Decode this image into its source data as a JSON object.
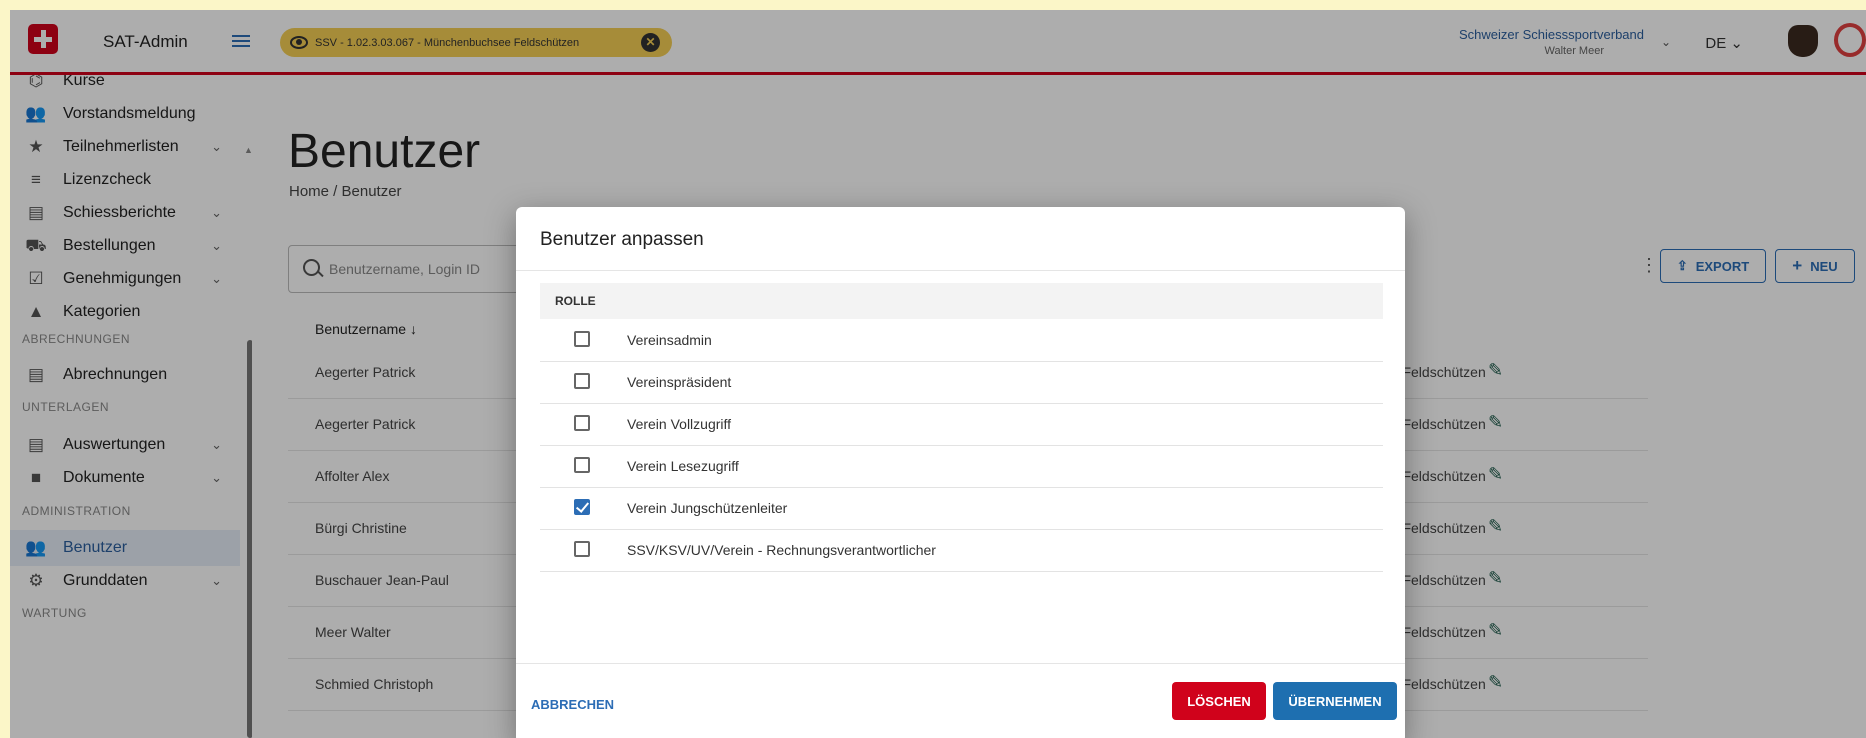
{
  "header": {
    "app_name": "SAT-Admin",
    "context_chip": "SSV - 1.02.3.03.067 - Münchenbuchsee Feldschützen",
    "org_name": "Schweizer Schiesssportverband",
    "user_name": "Walter Meer",
    "language": "DE"
  },
  "sidebar": {
    "items": [
      {
        "label": "Kurse",
        "icon": "course-icon"
      },
      {
        "label": "Vorstandsmeldung",
        "icon": "people-icon"
      },
      {
        "label": "Teilnehmerlisten",
        "icon": "star-icon"
      },
      {
        "label": "Lizenzcheck",
        "icon": "list-check-icon"
      },
      {
        "label": "Schiessberichte",
        "icon": "document-icon"
      },
      {
        "label": "Bestellungen",
        "icon": "cart-icon"
      },
      {
        "label": "Genehmigungen",
        "icon": "approval-icon"
      },
      {
        "label": "Kategorien",
        "icon": "category-icon"
      },
      {
        "label": "Abrechnungen",
        "icon": "ledger-icon"
      },
      {
        "label": "Auswertungen",
        "icon": "report-icon"
      },
      {
        "label": "Dokumente",
        "icon": "folder-icon"
      },
      {
        "label": "Benutzer",
        "icon": "people-icon"
      },
      {
        "label": "Grunddaten",
        "icon": "gear-icon"
      }
    ],
    "sections": [
      "ABRECHNUNGEN",
      "UNTERLAGEN",
      "ADMINISTRATION",
      "WARTUNG"
    ]
  },
  "page": {
    "title": "Benutzer",
    "breadcrumb": "Home / Benutzer",
    "search_placeholder": "Benutzername, Login ID",
    "column_username": "Benutzername ↓",
    "export_label": "EXPORT",
    "new_label": "NEU"
  },
  "table": {
    "rows": [
      {
        "name": "Aegerter Patrick",
        "verein": "ee Feldschützen"
      },
      {
        "name": "Aegerter Patrick",
        "verein": "ee Feldschützen"
      },
      {
        "name": "Affolter Alex",
        "verein": "ee Feldschützen"
      },
      {
        "name": "Bürgi Christine",
        "verein": "ee Feldschützen"
      },
      {
        "name": "Buschauer Jean-Paul",
        "verein": "ee Feldschützen"
      },
      {
        "name": "Meer Walter",
        "verein": "ee Feldschützen"
      },
      {
        "name": "Schmied Christoph",
        "verein": "ee Feldschützen"
      }
    ]
  },
  "dialog": {
    "title": "Benutzer anpassen",
    "column_role": "ROLLE",
    "roles": [
      {
        "label": "Vereinsadmin",
        "checked": false
      },
      {
        "label": "Vereinspräsident",
        "checked": false
      },
      {
        "label": "Verein Vollzugriff",
        "checked": false
      },
      {
        "label": "Verein Lesezugriff",
        "checked": false
      },
      {
        "label": "Verein Jungschützenleiter",
        "checked": true
      },
      {
        "label": "SSV/KSV/UV/Verein - Rechnungsverantwortlicher",
        "checked": false
      }
    ],
    "cancel_label": "ABBRECHEN",
    "delete_label": "LÖSCHEN",
    "apply_label": "ÜBERNEHMEN"
  },
  "colors": {
    "brand_red": "#d0021b",
    "primary_blue": "#2c6db5",
    "chip_yellow": "#f5cf55",
    "edit_green": "#1c5a4a"
  }
}
